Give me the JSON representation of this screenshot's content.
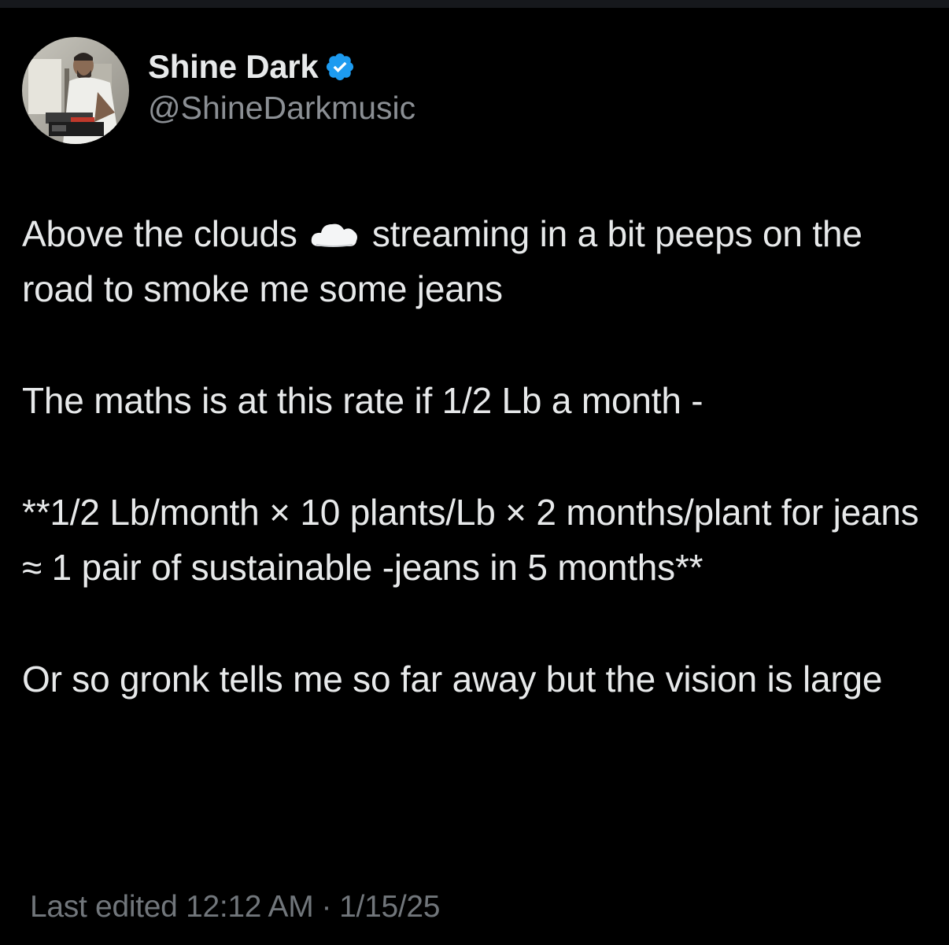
{
  "author": {
    "display_name": "Shine Dark",
    "handle": "@ShineDarkmusic",
    "verified_badge_icon": "verified-badge-icon",
    "avatar_icon": "user-avatar"
  },
  "tweet": {
    "para1_before_emoji": "Above the clouds ",
    "para1_emoji_icon": "cloud-icon",
    "para1_after_emoji": " streaming in a bit peeps on the road to smoke me some jeans",
    "para2": "The maths is at this rate if 1/2 Lb a month -",
    "para3": "**1/2 Lb/month × 10 plants/Lb × 2 months/plant for jeans ≈ 1 pair of sustainable -jeans in 5 months**",
    "para4": "Or so gronk tells me so far away but the vision is large"
  },
  "footer": {
    "edited_prefix": "Last edited",
    "time": "12:12 AM",
    "separator": "·",
    "date": "1/15/25"
  },
  "colors": {
    "background": "#000000",
    "primary_text": "#e7e9ea",
    "secondary_text": "#71767b",
    "verified_blue": "#1d9bf0"
  }
}
